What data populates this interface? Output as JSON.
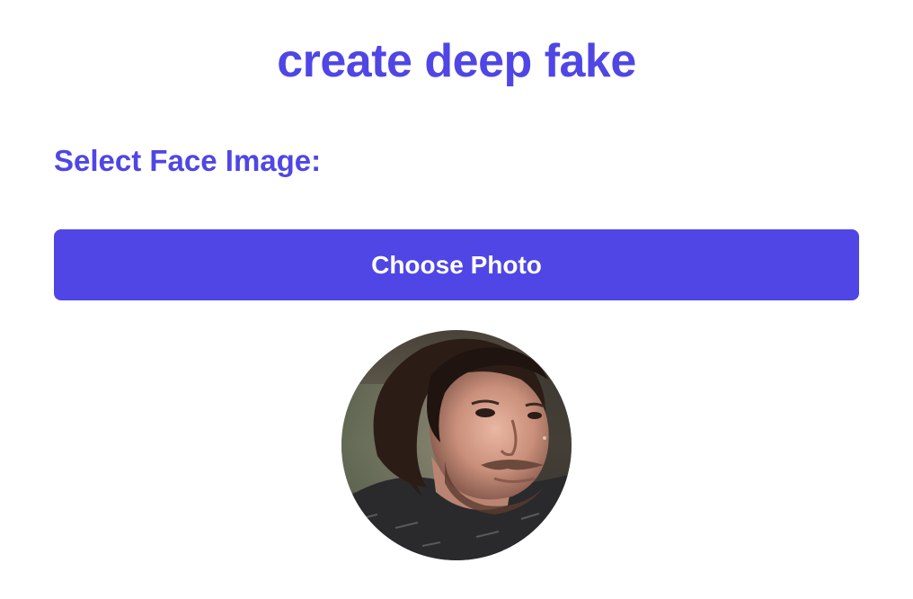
{
  "header": {
    "title": "create deep fake"
  },
  "form": {
    "face_label": "Select Face Image:",
    "choose_button_label": "Choose Photo"
  },
  "preview": {
    "image_kind": "circular face photo preview"
  },
  "colors": {
    "accent": "#4f46e5",
    "background": "#ffffff",
    "button_text": "#ffffff"
  }
}
